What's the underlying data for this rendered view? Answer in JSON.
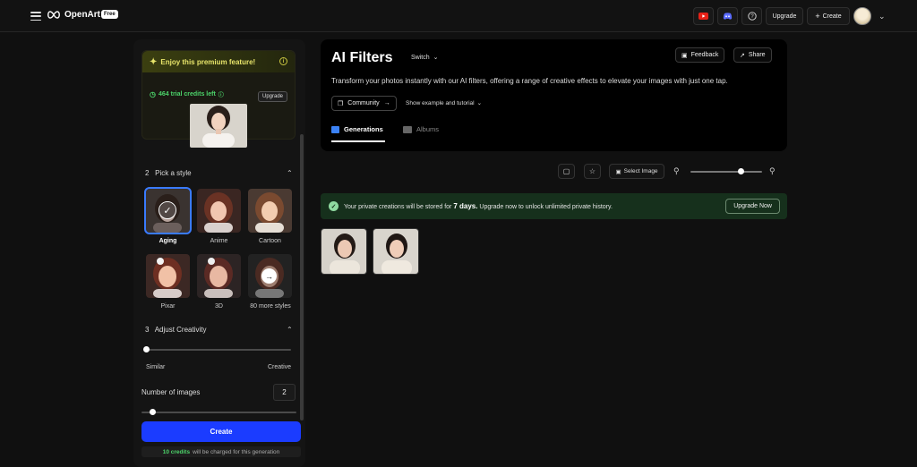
{
  "topbar": {
    "logo_text": "OpenArt",
    "plan_badge": "Free",
    "youtube_icon": "youtube-icon",
    "discord_icon": "discord-icon",
    "help_icon": "help-icon",
    "upgrade_label": "Upgrade",
    "create_label": "Create"
  },
  "sidebar": {
    "promo_title": "Enjoy this premium feature!",
    "credits_left": "464 trial credits left",
    "upgrade_label": "Upgrade",
    "pick_style": {
      "number": "2",
      "title": "Pick a style"
    },
    "styles": [
      {
        "label": "Aging",
        "selected": true
      },
      {
        "label": "Anime",
        "selected": false
      },
      {
        "label": "Cartoon",
        "selected": false
      },
      {
        "label": "Pixar",
        "selected": false
      },
      {
        "label": "3D",
        "selected": false
      },
      {
        "label": "80 more styles",
        "selected": false
      }
    ],
    "creativity": {
      "number": "3",
      "title": "Adjust Creativity",
      "min_label": "Similar",
      "max_label": "Creative",
      "value": 0
    },
    "num_images": {
      "label": "Number of images",
      "value": "2",
      "slider_fraction": 0.07
    },
    "create_label": "Create",
    "credits_note_amount": "10 credits",
    "credits_note_rest": "will be charged for this generation"
  },
  "hero": {
    "title": "AI Filters",
    "switch_label": "Switch",
    "feedback_label": "Feedback",
    "share_label": "Share",
    "description": "Transform your photos instantly with our AI filters, offering a range of creative effects to elevate your images with just one tap.",
    "community_label": "Community",
    "example_label": "Show example and tutorial",
    "tabs": [
      {
        "label": "Generations",
        "active": true
      },
      {
        "label": "Albums",
        "active": false
      }
    ]
  },
  "toolbar": {
    "select_image_label": "Select Image",
    "zoom_fraction": 0.7
  },
  "notice": {
    "text_before": "Your private creations will be stored for",
    "highlight": "7 days.",
    "text_after": "Upgrade now to unlock unlimited private history.",
    "button_label": "Upgrade Now"
  },
  "colors": {
    "accent_blue": "#1b3cff",
    "success_green": "#4cd46a",
    "promo_yellow": "#e8e56a",
    "notice_bg": "#16301c"
  }
}
